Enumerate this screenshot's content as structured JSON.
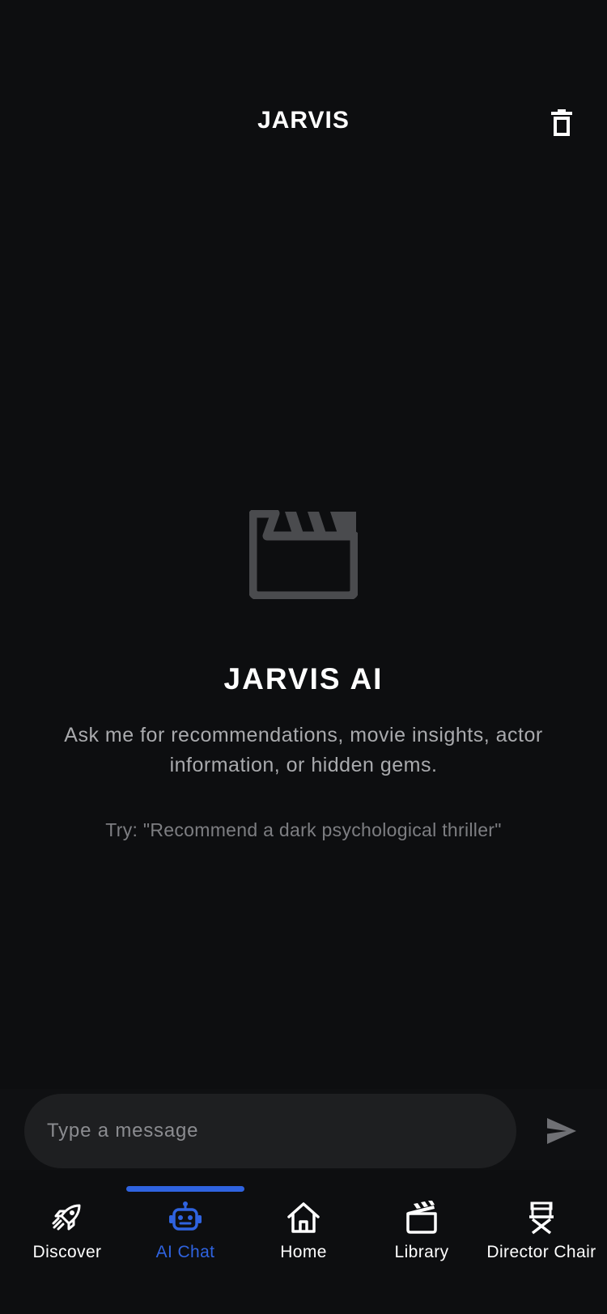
{
  "header": {
    "title": "JARVIS",
    "delete_icon": "trash-icon"
  },
  "empty_state": {
    "icon": "clapperboard-icon",
    "title": "JARVIS AI",
    "description": "Ask me for recommendations, movie insights, actor information, or hidden gems.",
    "hint": "Try: \"Recommend a dark psychological thriller\""
  },
  "composer": {
    "placeholder": "Type a message",
    "value": "",
    "send_icon": "send-icon"
  },
  "tabs": [
    {
      "label": "Discover",
      "icon": "rocket-icon",
      "active": false
    },
    {
      "label": "AI Chat",
      "icon": "robot-icon",
      "active": true
    },
    {
      "label": "Home",
      "icon": "home-icon",
      "active": false
    },
    {
      "label": "Library",
      "icon": "clapperboard-icon",
      "active": false
    },
    {
      "label": "Director Chair",
      "icon": "director-chair-icon",
      "active": false
    }
  ],
  "colors": {
    "background": "#0d0e10",
    "accent": "#2f63e0",
    "input_background": "#1e1f21",
    "muted_icon": "#4a4b4e"
  }
}
